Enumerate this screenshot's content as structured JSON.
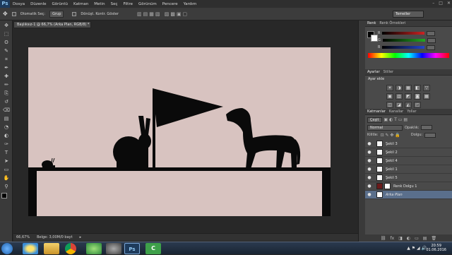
{
  "app": {
    "logo": "Ps",
    "menu": [
      "Dosya",
      "Düzenle",
      "Görüntü",
      "Katman",
      "Metin",
      "Seç",
      "Filtre",
      "Görünüm",
      "Pencere",
      "Yardım"
    ],
    "window_controls": [
      "–",
      "□",
      "✕"
    ]
  },
  "options": {
    "auto_select_label": "Otomatik Seç:",
    "auto_select_value": "Grup",
    "transform_label": "Dönüşt. Kontr. Göster",
    "workspace": "Temeller"
  },
  "document": {
    "tab_title": "Başlıksız-1 @ 66,7% (Arka Plan, RGB/8) *",
    "tab_close": "×"
  },
  "tools": [
    "move-tool",
    "marquee-tool",
    "lasso-tool",
    "quick-select-tool",
    "crop-tool",
    "eyedropper-tool",
    "healing-tool",
    "brush-tool",
    "clone-stamp-tool",
    "history-brush-tool",
    "eraser-tool",
    "gradient-tool",
    "blur-tool",
    "dodge-tool",
    "pen-tool",
    "type-tool",
    "path-select-tool",
    "shape-tool",
    "hand-tool",
    "zoom-tool"
  ],
  "tool_glyphs": [
    "✥",
    "⬚",
    "ʘ",
    "✎",
    "⌗",
    "✒",
    "✚",
    "✏",
    "⎘",
    "↺",
    "⌫",
    "▤",
    "◔",
    "◐",
    "✑",
    "T",
    "➤",
    "▭",
    "✋",
    "⚲"
  ],
  "status": {
    "zoom": "66,67%",
    "doc_info": "Belge: 3,00M/0 bayt"
  },
  "color_panel": {
    "tabs": [
      "Renk",
      "Renk Örnekleri"
    ],
    "channels": [
      {
        "label": "R",
        "color": "#cc2222"
      },
      {
        "label": "G",
        "color": "#22aa22"
      },
      {
        "label": "B",
        "color": "#2244cc"
      }
    ]
  },
  "adjust_panel": {
    "tabs": [
      "Ayarlar",
      "Stiller"
    ],
    "heading": "Ayar ekle",
    "icons": [
      "☀",
      "◑",
      "▦",
      "◧",
      "▽",
      "▣",
      "▥",
      "◩",
      "◙",
      "▦",
      "◫",
      "◪",
      "◭",
      "◰"
    ]
  },
  "layers_panel": {
    "tabs": [
      "Katmanlar",
      "Kanallar",
      "Yollar"
    ],
    "filter_label": "Çeşit",
    "blend_mode": "Normal",
    "opacity_label": "Opaklık:",
    "lock_label": "Kilitle:",
    "fill_label": "Dolgu:",
    "layers": [
      {
        "name": "Şekil 3",
        "eye": "●",
        "thumb": "#f5f5f5",
        "mask": false,
        "selected": false
      },
      {
        "name": "Şekil 2",
        "eye": "●",
        "thumb": "#f5f5f5",
        "mask": false,
        "selected": false
      },
      {
        "name": "Şekil 4",
        "eye": "●",
        "thumb": "#f5f5f5",
        "mask": false,
        "selected": false
      },
      {
        "name": "Şekil 1",
        "eye": "●",
        "thumb": "#f5f5f5",
        "mask": false,
        "selected": false
      },
      {
        "name": "Şekil 5",
        "eye": "●",
        "thumb": "#f5f5f5",
        "mask": false,
        "selected": false
      },
      {
        "name": "Renk Dolgu 1",
        "eye": "●",
        "thumb": "#6b1a1a",
        "mask": true,
        "selected": false
      },
      {
        "name": "Arka Plan",
        "eye": "●",
        "thumb": "#ffffff",
        "mask": false,
        "selected": true
      }
    ],
    "footer_icons": [
      "⛓",
      "fx",
      "◨",
      "◐",
      "▭",
      "▤",
      "🗑"
    ]
  },
  "taskbar": {
    "apps": [
      "start",
      "ie",
      "explorer",
      "chrome",
      "media",
      "app",
      "photoshop",
      "camtasia"
    ],
    "tray": "▲ ⚑ ◢ 🔊",
    "time": "20:59",
    "date": "01.06.2016"
  },
  "colors": {
    "canvas_bg": "#d8c3c0",
    "silhouette": "#0a0a0a",
    "selection_blue": "#5a6f8c"
  }
}
